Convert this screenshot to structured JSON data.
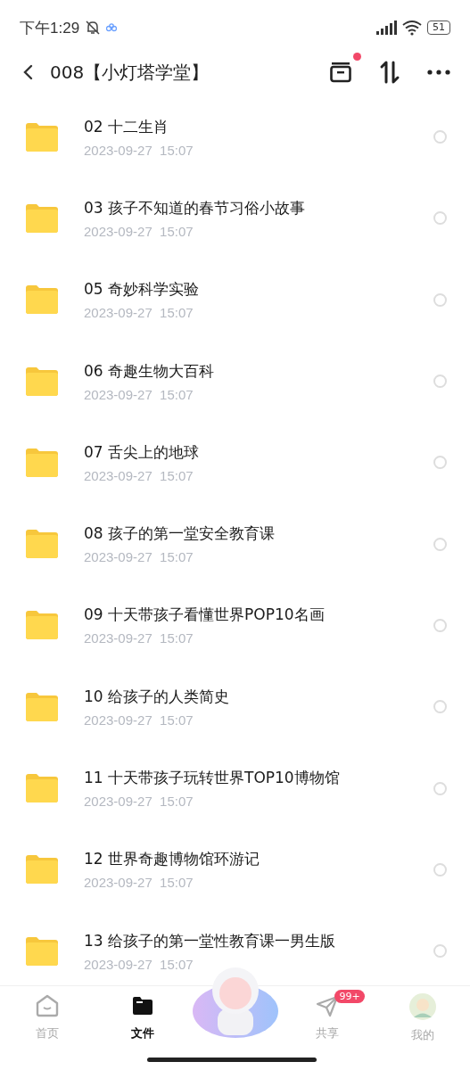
{
  "status_bar": {
    "time": "下午1:29",
    "battery": "51"
  },
  "header": {
    "title": "008【小灯塔学堂】",
    "archive_dot": true
  },
  "files": [
    {
      "name": "02 十二生肖",
      "date": "2023-09-27  15:07",
      "checked": false
    },
    {
      "name": "03 孩子不知道的春节习俗小故事",
      "date": "2023-09-27  15:07",
      "checked": false
    },
    {
      "name": "05 奇妙科学实验",
      "date": "2023-09-27  15:07",
      "checked": false
    },
    {
      "name": "06 奇趣生物大百科",
      "date": "2023-09-27  15:07",
      "checked": false
    },
    {
      "name": "07 舌尖上的地球",
      "date": "2023-09-27  15:07",
      "checked": false
    },
    {
      "name": "08 孩子的第一堂安全教育课",
      "date": "2023-09-27  15:07",
      "checked": false
    },
    {
      "name": "09  十天带孩子看懂世界POP10名画",
      "date": "2023-09-27  15:07",
      "checked": false
    },
    {
      "name": "10 给孩子的人类简史",
      "date": "2023-09-27  15:07",
      "checked": false
    },
    {
      "name": "11 十天带孩子玩转世界TOP10博物馆",
      "date": "2023-09-27  15:07",
      "checked": false
    },
    {
      "name": "12 世界奇趣博物馆环游记",
      "date": "2023-09-27  15:07",
      "checked": false
    },
    {
      "name": "13 给孩子的第一堂性教育课一男生版",
      "date": "2023-09-27  15:07",
      "checked": false
    }
  ],
  "tabs": [
    {
      "kind": "home",
      "label": "首页",
      "selected": false
    },
    {
      "kind": "files",
      "label": "文件",
      "selected": true
    },
    {
      "kind": "mascot"
    },
    {
      "kind": "share",
      "label": "共享",
      "selected": false,
      "badge": "99+"
    },
    {
      "kind": "me",
      "label": "我的",
      "selected": false
    }
  ]
}
